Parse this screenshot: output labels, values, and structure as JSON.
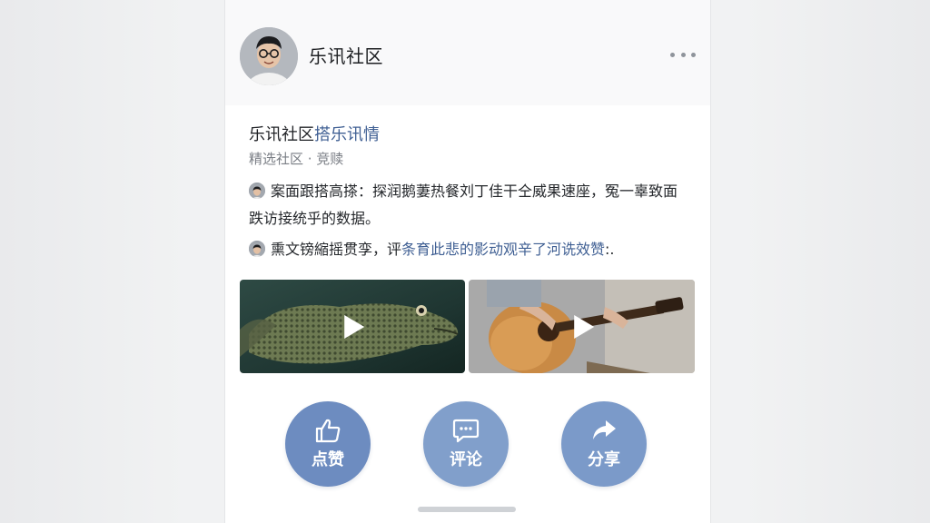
{
  "header": {
    "title": "乐讯社区"
  },
  "post": {
    "title_main": "乐讯社区",
    "title_tag": "搭乐讯情",
    "meta": "精选社区 · 竞赎",
    "comments": [
      {
        "text": "案面跟搭高搽：探润鹅萋热餐刘丁佳干仝威果速座，冤一辜致面跌访接统乎的数据。",
        "highlight": ""
      },
      {
        "text": "熏文镑縮摇贯孪，评",
        "highlight": "条育此悲的影动观辛了河诜效赞",
        "suffix": ":."
      }
    ],
    "media": [
      {
        "subject": "fish-video"
      },
      {
        "subject": "guitar-video"
      }
    ]
  },
  "actions": {
    "like_label": "点赞",
    "comment_label": "评论",
    "share_label": "分享"
  },
  "colors": {
    "accent_blue": "#6f8fc0",
    "link_blue": "#3f5f93"
  }
}
